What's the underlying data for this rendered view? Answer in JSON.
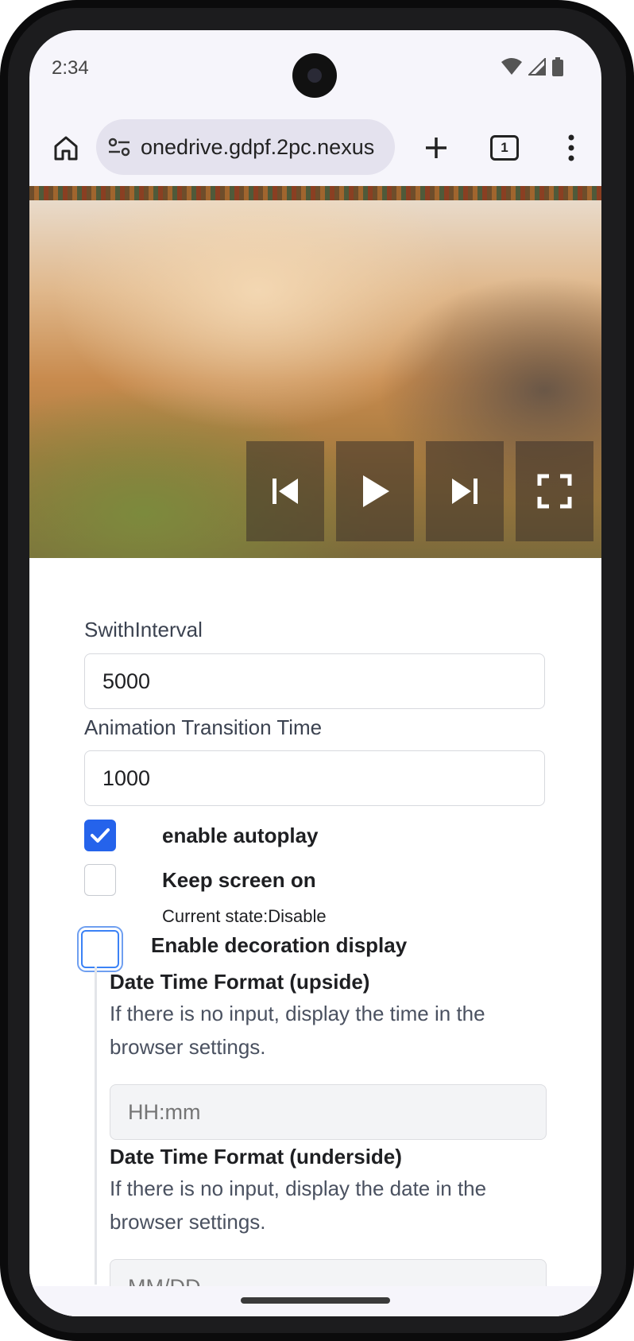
{
  "status_bar": {
    "time": "2:34",
    "icons": [
      "wifi-icon",
      "signal-icon",
      "battery-icon"
    ]
  },
  "browser": {
    "url": "onedrive.gdpf.2pc.nexus",
    "tab_count": "1",
    "icons": [
      "home-icon",
      "site-settings-icon",
      "plus-icon",
      "tab-switcher-icon",
      "more-vert-icon"
    ]
  },
  "player": {
    "controls": [
      "skip-previous-icon",
      "play-icon",
      "skip-next-icon",
      "fullscreen-icon"
    ]
  },
  "form": {
    "switch_interval": {
      "label": "SwithInterval",
      "value": "5000"
    },
    "transition_time": {
      "label": "Animation Transition Time",
      "value": "1000"
    },
    "autoplay": {
      "label": "enable autoplay",
      "checked": true
    },
    "keep_screen_on": {
      "label": "Keep screen on",
      "checked": false,
      "state": "Current state:Disable"
    },
    "decoration": {
      "label": "Enable decoration display",
      "checked": false
    },
    "upside": {
      "title": "Date Time Format (upside)",
      "help": "If there is no input, display the time in the browser settings.",
      "placeholder": "HH:mm"
    },
    "underside": {
      "title": "Date Time Format (underside)",
      "help": "If there is no input, display the date in the browser settings.",
      "placeholder": "MM/DD"
    }
  },
  "colors": {
    "accent": "#2563eb",
    "focus_ring": "#6f9ff0",
    "label": "#3b4250"
  }
}
